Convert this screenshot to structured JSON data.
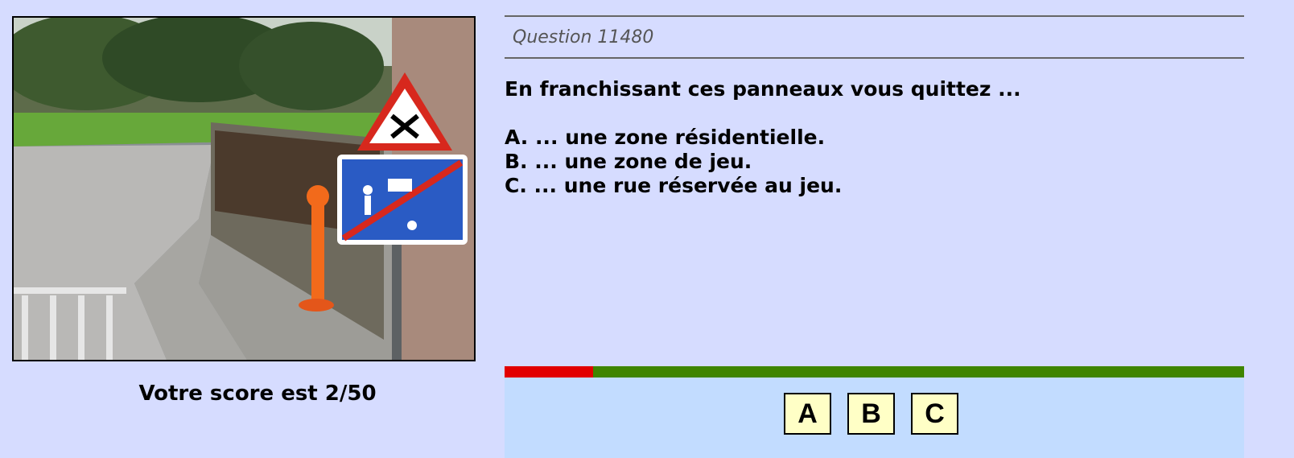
{
  "question": {
    "header": "Question 11480",
    "text": "En franchissant ces panneaux vous quittez ...",
    "choices": [
      "A. ... une zone résidentielle.",
      "B. ... une zone de jeu.",
      "C. ... une rue réservée au jeu."
    ]
  },
  "score": {
    "label": "Votre score est 2/50"
  },
  "timer": {
    "elapsed_fraction": 0.12,
    "elapsed_color": "#e20000",
    "remaining_color": "#3f8500"
  },
  "answers": {
    "buttons": [
      "A",
      "B",
      "C"
    ]
  },
  "photo": {
    "depicts": [
      "priority-crossroad-warning-sign-icon",
      "end-of-residential-zone-sign-icon",
      "orange-bollard-icon"
    ]
  },
  "colors": {
    "page_background": "#d6dcff",
    "answer_panel": "#c2dcff",
    "answer_button": "#ffffc6"
  }
}
